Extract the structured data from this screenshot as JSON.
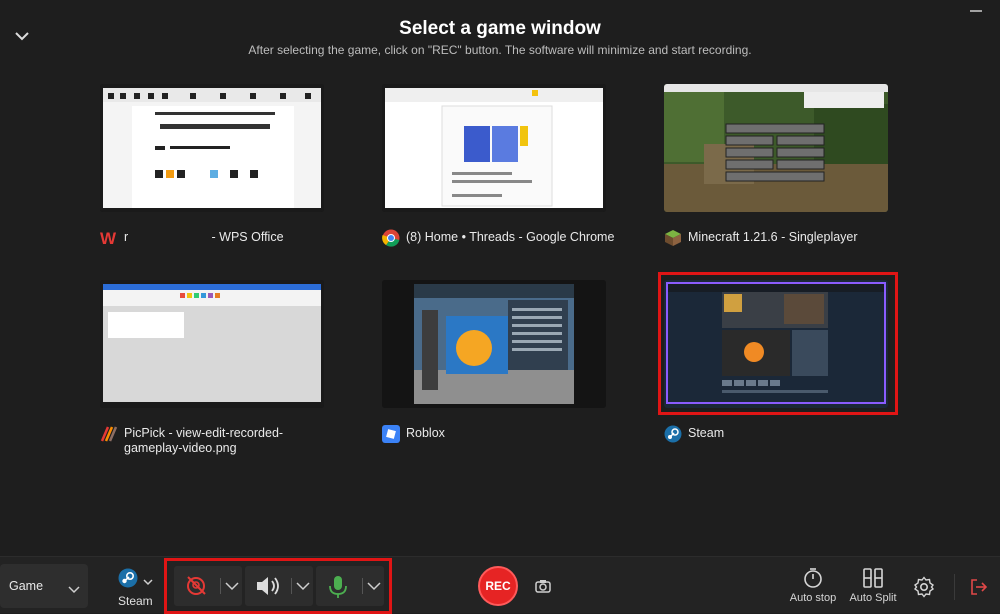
{
  "header": {
    "title": "Select a game window",
    "subtitle": "After selecting the game, click on \"REC\" button. The software will minimize and start recording."
  },
  "windows": [
    {
      "label": "r                        - WPS Office",
      "icon": "wps-office-icon"
    },
    {
      "label": "(8) Home • Threads - Google Chrome",
      "icon": "chrome-icon"
    },
    {
      "label": "Minecraft 1.21.6 - Singleplayer",
      "icon": "minecraft-icon"
    },
    {
      "label": "PicPick - view-edit-recorded-gameplay-video.png",
      "icon": "picpick-icon"
    },
    {
      "label": "Roblox",
      "icon": "roblox-icon"
    },
    {
      "label": "Steam",
      "icon": "steam-icon",
      "selected": true
    }
  ],
  "toolbar": {
    "mode": "Game",
    "target": "Steam",
    "rec_label": "REC",
    "auto_stop": "Auto stop",
    "auto_split": "Auto Split"
  },
  "colors": {
    "highlight": "#e01515",
    "rec": "#e62424",
    "mic": "#4caf50",
    "webcam_off": "#e53935"
  }
}
